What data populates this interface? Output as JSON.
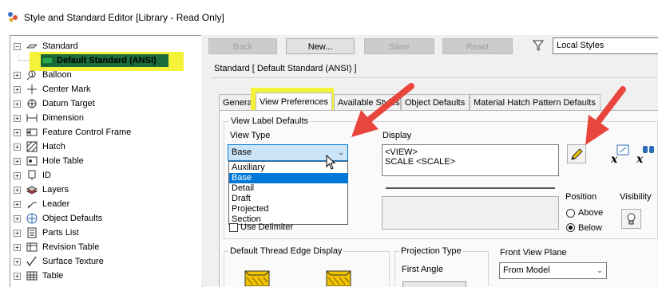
{
  "window": {
    "title": "Style and Standard Editor [Library - Read Only]"
  },
  "tree": {
    "root": {
      "label": "Standard"
    },
    "selected_child": {
      "label": "Default Standard (ANSI)"
    },
    "items": [
      {
        "label": "Balloon",
        "icon": "balloon-icon"
      },
      {
        "label": "Center Mark",
        "icon": "center-mark-icon"
      },
      {
        "label": "Datum Target",
        "icon": "datum-target-icon"
      },
      {
        "label": "Dimension",
        "icon": "dimension-icon"
      },
      {
        "label": "Feature Control Frame",
        "icon": "feature-control-frame-icon"
      },
      {
        "label": "Hatch",
        "icon": "hatch-icon"
      },
      {
        "label": "Hole Table",
        "icon": "hole-table-icon"
      },
      {
        "label": "ID",
        "icon": "id-icon"
      },
      {
        "label": "Layers",
        "icon": "layers-icon"
      },
      {
        "label": "Leader",
        "icon": "leader-icon"
      },
      {
        "label": "Object Defaults",
        "icon": "object-defaults-icon"
      },
      {
        "label": "Parts List",
        "icon": "parts-list-icon"
      },
      {
        "label": "Revision Table",
        "icon": "revision-table-icon"
      },
      {
        "label": "Surface Texture",
        "icon": "surface-texture-icon"
      },
      {
        "label": "Table",
        "icon": "table-icon"
      }
    ]
  },
  "toolbar": {
    "back": "Back",
    "new": "New...",
    "save": "Save",
    "reset": "Reset",
    "filter_value": "Local Styles"
  },
  "header": {
    "standard_title": "Standard [ Default Standard (ANSI) ]"
  },
  "tabs": [
    "General",
    "View Preferences",
    "Available Styles",
    "Object Defaults",
    "Material Hatch Pattern Defaults"
  ],
  "view_label": {
    "group_title": "View Label Defaults",
    "view_type_label": "View Type",
    "view_type_value": "Base",
    "options": [
      "Auxiliary",
      "Base",
      "Detail",
      "Draft",
      "Projected",
      "Section"
    ],
    "selected_option": "Base",
    "display_label": "Display",
    "display_lines": [
      "<VIEW>",
      "SCALE <SCALE>"
    ],
    "use_delimiter": "Use Delimiter",
    "position_label": "Position",
    "above": "Above",
    "below": "Below",
    "position_selected": "Below",
    "visibility_label": "Visibility"
  },
  "thread_edge": {
    "title": "Default Thread Edge Display"
  },
  "projection": {
    "title": "Projection Type",
    "value": "First Angle"
  },
  "front_view": {
    "title": "Front View Plane",
    "value": "From Model"
  },
  "colors": {
    "highlight": "#f5f23a",
    "selection": "#0078d7",
    "arrow": "#e8453c"
  }
}
